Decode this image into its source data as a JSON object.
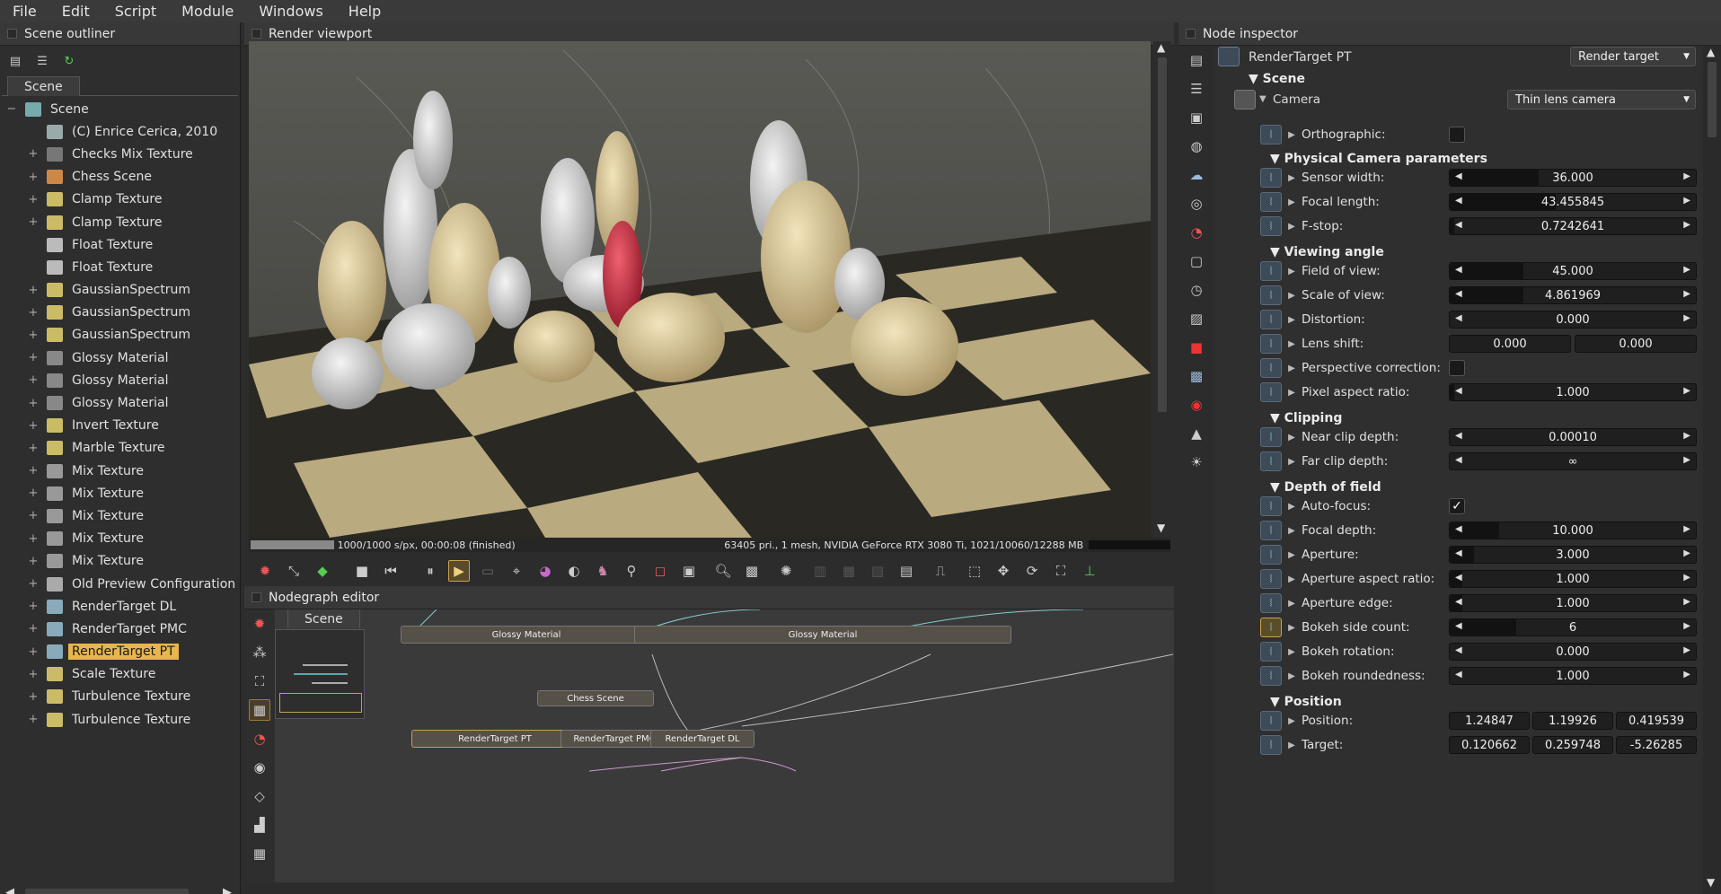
{
  "menu": [
    "File",
    "Edit",
    "Script",
    "Module",
    "Windows",
    "Help"
  ],
  "outliner": {
    "title": "Scene outliner",
    "tab": "Scene",
    "root": "Scene",
    "items": [
      {
        "label": "(C) Enrice Cerica, 2010",
        "icon": "comment-icon",
        "color": "#9aa",
        "expand": false
      },
      {
        "label": "Checks Mix Texture",
        "icon": "checker-texture-icon",
        "color": "#777",
        "expand": true
      },
      {
        "label": "Chess Scene",
        "icon": "chess-scene-icon",
        "color": "#c84",
        "expand": true
      },
      {
        "label": "Clamp Texture",
        "icon": "image-texture-icon",
        "color": "#cb6",
        "expand": true
      },
      {
        "label": "Clamp Texture",
        "icon": "image-texture-icon",
        "color": "#cb6",
        "expand": true
      },
      {
        "label": "Float Texture",
        "icon": "float-texture-icon",
        "color": "#bbb",
        "expand": false
      },
      {
        "label": "Float Texture",
        "icon": "float-texture-icon",
        "color": "#bbb",
        "expand": false
      },
      {
        "label": "GaussianSpectrum",
        "icon": "spectrum-icon",
        "color": "#cb6",
        "expand": true
      },
      {
        "label": "GaussianSpectrum",
        "icon": "spectrum-icon",
        "color": "#cb6",
        "expand": true
      },
      {
        "label": "GaussianSpectrum",
        "icon": "spectrum-icon",
        "color": "#cb6",
        "expand": true
      },
      {
        "label": "Glossy Material",
        "icon": "material-sphere-icon",
        "color": "#888",
        "expand": true
      },
      {
        "label": "Glossy Material",
        "icon": "material-sphere-icon",
        "color": "#888",
        "expand": true
      },
      {
        "label": "Glossy Material",
        "icon": "material-sphere-icon",
        "color": "#888",
        "expand": true
      },
      {
        "label": "Invert Texture",
        "icon": "image-texture-icon",
        "color": "#cb6",
        "expand": true
      },
      {
        "label": "Marble Texture",
        "icon": "image-texture-icon",
        "color": "#cb6",
        "expand": true
      },
      {
        "label": "Mix Texture",
        "icon": "mix-texture-icon",
        "color": "#999",
        "expand": true
      },
      {
        "label": "Mix Texture",
        "icon": "mix-texture-icon",
        "color": "#999",
        "expand": true
      },
      {
        "label": "Mix Texture",
        "icon": "mix-texture-icon",
        "color": "#999",
        "expand": true
      },
      {
        "label": "Mix Texture",
        "icon": "mix-texture-icon",
        "color": "#999",
        "expand": true
      },
      {
        "label": "Mix Texture",
        "icon": "mix-texture-icon",
        "color": "#999",
        "expand": true
      },
      {
        "label": "Old Preview Configuration",
        "icon": "preview-config-icon",
        "color": "#aaa",
        "expand": true
      },
      {
        "label": "RenderTarget DL",
        "icon": "render-target-icon",
        "color": "#8ab",
        "expand": true
      },
      {
        "label": "RenderTarget PMC",
        "icon": "render-target-icon",
        "color": "#8ab",
        "expand": true
      },
      {
        "label": "RenderTarget PT",
        "icon": "render-target-icon",
        "color": "#8ab",
        "expand": true,
        "selected": true
      },
      {
        "label": "Scale Texture",
        "icon": "image-texture-icon",
        "color": "#cb6",
        "expand": true
      },
      {
        "label": "Turbulence Texture",
        "icon": "image-texture-icon",
        "color": "#cb6",
        "expand": true
      },
      {
        "label": "Turbulence Texture",
        "icon": "image-texture-icon",
        "color": "#cb6",
        "expand": true
      }
    ]
  },
  "viewport": {
    "title": "Render viewport",
    "status_left": "1000/1000 s/px, 00:00:08 (finished)",
    "status_right": "63405 pri., 1 mesh, NVIDIA GeForce RTX 3080 Ti, 1021/10060/12288 MB",
    "progress": 1.0
  },
  "nodegraph": {
    "title": "Nodegraph editor",
    "tab": "Scene",
    "nodes": [
      "Glossy Material",
      "Glossy Material",
      "Chess Scene",
      "RenderTarget PT",
      "RenderTarget PMC",
      "RenderTarget DL"
    ]
  },
  "inspector": {
    "title": "Node inspector",
    "node_name": "RenderTarget PT",
    "node_type": "Render target",
    "section_scene": "Scene",
    "camera_label": "Camera",
    "camera_type": "Thin lens camera",
    "orthographic": "Orthographic:",
    "sections": {
      "physical": "Physical Camera parameters",
      "viewing": "Viewing angle",
      "clipping": "Clipping",
      "dof": "Depth of field",
      "position": "Position"
    },
    "params": {
      "sensor_width": {
        "label": "Sensor width:",
        "value": "36.000",
        "fill": 0.36
      },
      "focal_length": {
        "label": "Focal length:",
        "value": "43.455845",
        "fill": 0.43
      },
      "fstop": {
        "label": "F-stop:",
        "value": "0.7242641",
        "fill": 0.02
      },
      "fov": {
        "label": "Field of view:",
        "value": "45.000",
        "fill": 0.3
      },
      "scale_view": {
        "label": "Scale of view:",
        "value": "4.861969",
        "fill": 0.3
      },
      "distortion": {
        "label": "Distortion:",
        "value": "0.000",
        "fill": 0.0
      },
      "lens_shift": {
        "label": "Lens shift:",
        "value_x": "0.000",
        "value_y": "0.000"
      },
      "persp_corr": {
        "label": "Perspective correction:"
      },
      "pixel_aspect": {
        "label": "Pixel aspect ratio:",
        "value": "1.000",
        "fill": 0.02
      },
      "near_clip": {
        "label": "Near clip depth:",
        "value": "0.00010",
        "fill": 0.0
      },
      "far_clip": {
        "label": "Far clip depth:",
        "value": "∞",
        "fill": 0.0
      },
      "autofocus": {
        "label": "Auto-focus:"
      },
      "focal_depth": {
        "label": "Focal depth:",
        "value": "10.000",
        "fill": 0.2
      },
      "aperture": {
        "label": "Aperture:",
        "value": "3.000",
        "fill": 0.1
      },
      "aperture_aspect": {
        "label": "Aperture aspect ratio:",
        "value": "1.000",
        "fill": 0.05
      },
      "aperture_edge": {
        "label": "Aperture edge:",
        "value": "1.000",
        "fill": 0.05
      },
      "bokeh_side": {
        "label": "Bokeh side count:",
        "value": "6",
        "fill": 0.27
      },
      "bokeh_rot": {
        "label": "Bokeh rotation:",
        "value": "0.000",
        "fill": 0.0
      },
      "bokeh_round": {
        "label": "Bokeh roundedness:",
        "value": "1.000",
        "fill": 0.0
      },
      "position": {
        "label": "Position:",
        "x": "1.24847",
        "y": "1.19926",
        "z": "0.419539"
      },
      "target": {
        "label": "Target:",
        "x": "0.120662",
        "y": "0.259748",
        "z": "-5.26285"
      }
    }
  }
}
